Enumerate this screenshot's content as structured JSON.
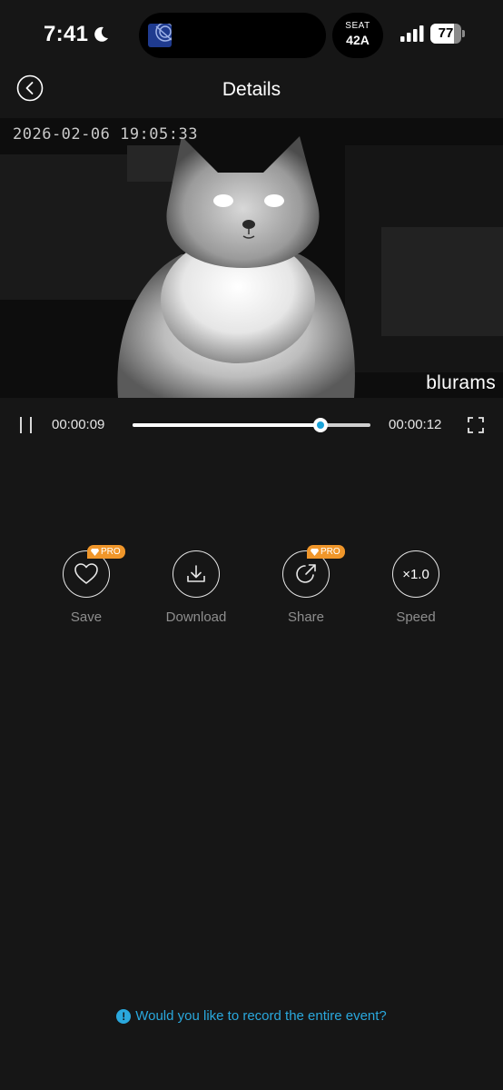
{
  "status_bar": {
    "time": "7:41",
    "seat_label": "SEAT",
    "seat_value": "42A",
    "battery_level": 77,
    "battery_text": "77"
  },
  "header": {
    "title": "Details"
  },
  "video": {
    "timestamp": "2026-02-06  19:05:33",
    "watermark": "blurams"
  },
  "player": {
    "current_time": "00:00:09",
    "total_time": "00:00:12",
    "progress": 0.79
  },
  "actions": [
    {
      "label": "Save",
      "icon": "heart-icon",
      "badge": "PRO"
    },
    {
      "label": "Download",
      "icon": "download-icon",
      "badge": ""
    },
    {
      "label": "Share",
      "icon": "share-icon",
      "badge": "PRO"
    },
    {
      "label": "Speed",
      "icon": "speed-icon",
      "value": "×1.0"
    }
  ],
  "footer": {
    "record_prompt": "Would you like to record the entire event?"
  },
  "colors": {
    "background": "#161616",
    "accent": "#2aa8dd",
    "pro_badge": "#f0962a"
  }
}
